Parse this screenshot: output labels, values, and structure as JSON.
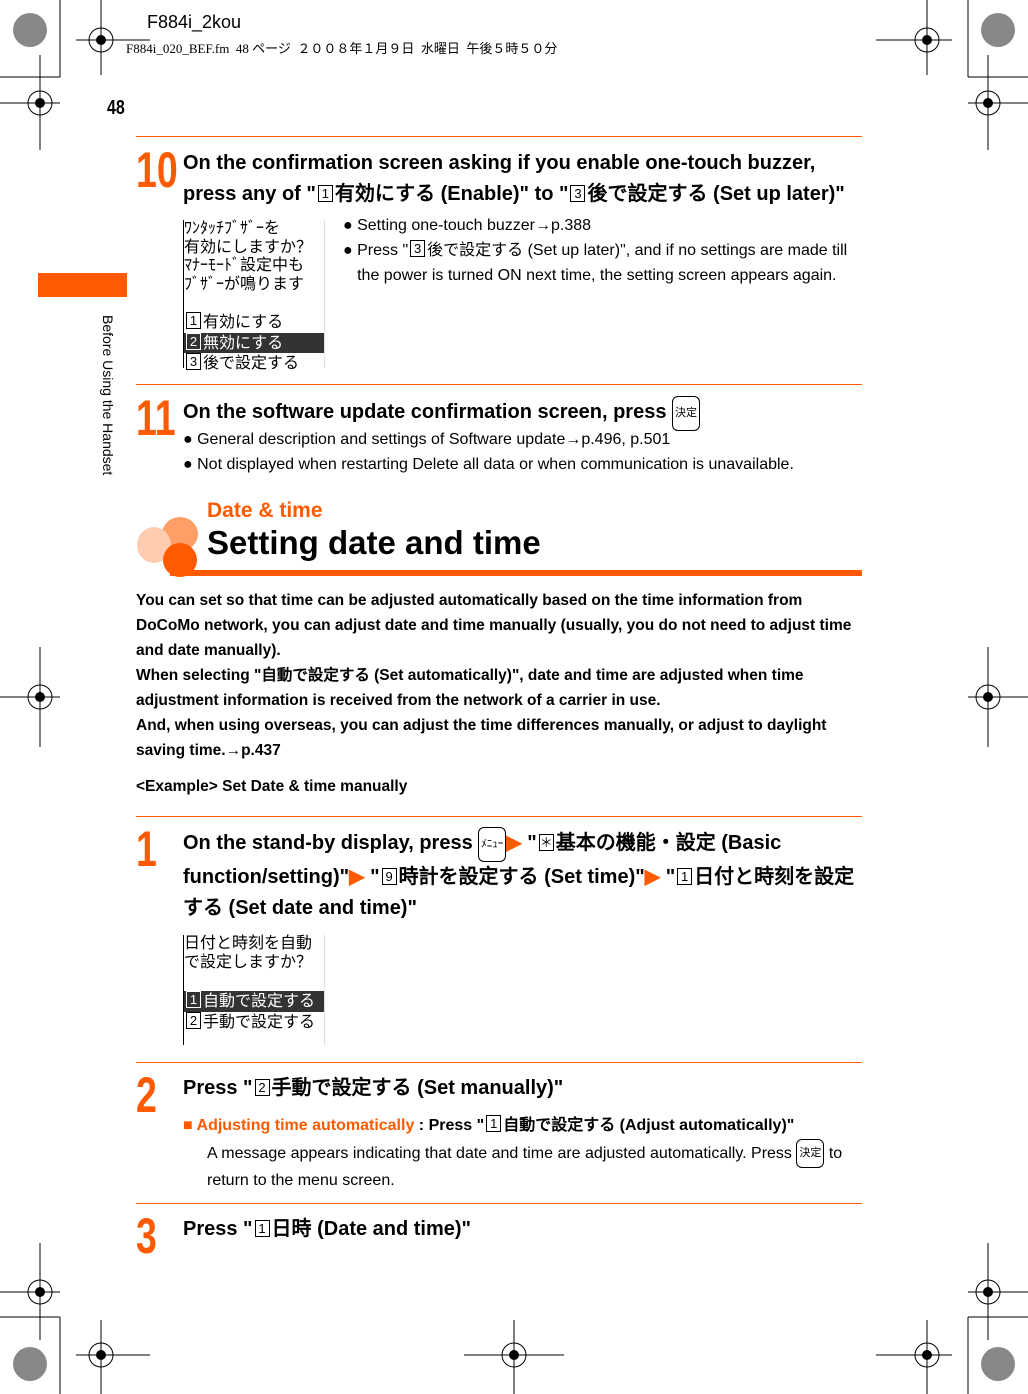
{
  "header": {
    "file": "F884i_2kou",
    "meta": "F884i_020_BEF.fm  48 ページ  ２００８年１月９日  水曜日  午後５時５０分"
  },
  "page_number": "48",
  "side_label": "Before Using the Handset",
  "accent": "#ff5a00",
  "step10": {
    "num": "10",
    "t1": "On the confirmation screen asking if you enable one-touch buzzer, press any of \"",
    "k1": "1",
    "t2": "有効にする (Enable)\" to \"",
    "k2": "3",
    "t3": "後で設定する (Set up later)\"",
    "screen": [
      "ﾜﾝﾀｯﾁﾌﾞｻﾞｰを",
      "有効にしますか？",
      "ﾏﾅｰﾓｰﾄﾞ設定中も",
      "ﾌﾞｻﾞｰが鳴ります"
    ],
    "options": [
      {
        "k": "1",
        "label": "有効にする"
      },
      {
        "k": "2",
        "label": "無効にする"
      },
      {
        "k": "3",
        "label": "後で設定する"
      }
    ],
    "b1": "Setting one-touch buzzer→p.388",
    "b2a": "Press \"",
    "b2k": "3",
    "b2b": "後で設定する (Set up later)\", and if no settings are made till the power is turned ON next time, the setting screen appears again."
  },
  "step11": {
    "num": "11",
    "title": "On the software update confirmation screen, press",
    "key": "決定",
    "b1": "General description and settings of Software update→p.496, p.501",
    "b2": "Not displayed when restarting Delete all data or when communication is unavailable."
  },
  "section": {
    "category": "Date & time",
    "title": "Setting date and time"
  },
  "intro": {
    "p1": "You can set so that time can be adjusted automatically based on the time information from DoCoMo network, you can adjust date and time manually (usually, you do not need to adjust time and date manually).",
    "p2": "When selecting \"自動で設定する (Set automatically)\", date and time are adjusted when time adjustment information is received from the network of a carrier in use.",
    "p3": "And, when using overseas, you can adjust the time differences manually, or adjust to daylight saving time.→p.437",
    "example": "<Example> Set Date & time manually"
  },
  "step1": {
    "num": "1",
    "t1": "On the stand-by display, press",
    "menu_key": "ﾒﾆｭｰ",
    "t2": "\"",
    "k1": "＊",
    "t3": "基本の機能・設定 (Basic function/setting)\"",
    "t4": "\"",
    "k2": "9",
    "t5": "時計を設定する (Set time)\"",
    "t6": "\"",
    "k3": "1",
    "t7": "日付と時刻を設定する (Set date and time)\"",
    "screen": [
      "日付と時刻を自動",
      "で設定しますか？"
    ],
    "options": [
      {
        "k": "1",
        "label": "自動で設定する"
      },
      {
        "k": "2",
        "label": "手動で設定する"
      }
    ]
  },
  "step2": {
    "num": "2",
    "t1": "Press \"",
    "k1": "2",
    "t2": "手動で設定する (Set manually)\"",
    "note_label": "Adjusting time automatically",
    "note_a": " : Press \"",
    "note_k": "1",
    "note_b": "自動で設定する (Adjust automatically)\"",
    "desc": "A message appears indicating that date and time are adjusted automatically. Press",
    "desc_key": "決定",
    "desc2": "to return to the menu screen."
  },
  "step3": {
    "num": "3",
    "t1": "Press \"",
    "k1": "1",
    "t2": "日時 (Date and time)\""
  }
}
